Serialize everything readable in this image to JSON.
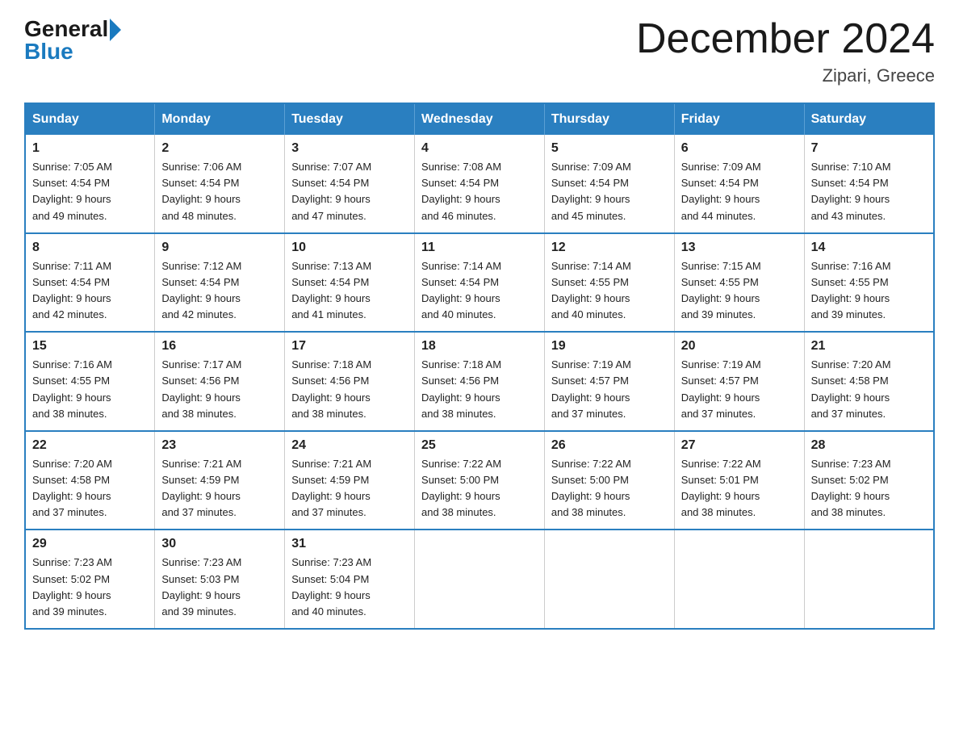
{
  "header": {
    "logo": {
      "general": "General",
      "blue": "Blue"
    },
    "title": "December 2024",
    "location": "Zipari, Greece"
  },
  "calendar": {
    "days_of_week": [
      "Sunday",
      "Monday",
      "Tuesday",
      "Wednesday",
      "Thursday",
      "Friday",
      "Saturday"
    ],
    "weeks": [
      [
        {
          "day": "1",
          "sunrise": "7:05 AM",
          "sunset": "4:54 PM",
          "daylight": "9 hours and 49 minutes."
        },
        {
          "day": "2",
          "sunrise": "7:06 AM",
          "sunset": "4:54 PM",
          "daylight": "9 hours and 48 minutes."
        },
        {
          "day": "3",
          "sunrise": "7:07 AM",
          "sunset": "4:54 PM",
          "daylight": "9 hours and 47 minutes."
        },
        {
          "day": "4",
          "sunrise": "7:08 AM",
          "sunset": "4:54 PM",
          "daylight": "9 hours and 46 minutes."
        },
        {
          "day": "5",
          "sunrise": "7:09 AM",
          "sunset": "4:54 PM",
          "daylight": "9 hours and 45 minutes."
        },
        {
          "day": "6",
          "sunrise": "7:09 AM",
          "sunset": "4:54 PM",
          "daylight": "9 hours and 44 minutes."
        },
        {
          "day": "7",
          "sunrise": "7:10 AM",
          "sunset": "4:54 PM",
          "daylight": "9 hours and 43 minutes."
        }
      ],
      [
        {
          "day": "8",
          "sunrise": "7:11 AM",
          "sunset": "4:54 PM",
          "daylight": "9 hours and 42 minutes."
        },
        {
          "day": "9",
          "sunrise": "7:12 AM",
          "sunset": "4:54 PM",
          "daylight": "9 hours and 42 minutes."
        },
        {
          "day": "10",
          "sunrise": "7:13 AM",
          "sunset": "4:54 PM",
          "daylight": "9 hours and 41 minutes."
        },
        {
          "day": "11",
          "sunrise": "7:14 AM",
          "sunset": "4:54 PM",
          "daylight": "9 hours and 40 minutes."
        },
        {
          "day": "12",
          "sunrise": "7:14 AM",
          "sunset": "4:55 PM",
          "daylight": "9 hours and 40 minutes."
        },
        {
          "day": "13",
          "sunrise": "7:15 AM",
          "sunset": "4:55 PM",
          "daylight": "9 hours and 39 minutes."
        },
        {
          "day": "14",
          "sunrise": "7:16 AM",
          "sunset": "4:55 PM",
          "daylight": "9 hours and 39 minutes."
        }
      ],
      [
        {
          "day": "15",
          "sunrise": "7:16 AM",
          "sunset": "4:55 PM",
          "daylight": "9 hours and 38 minutes."
        },
        {
          "day": "16",
          "sunrise": "7:17 AM",
          "sunset": "4:56 PM",
          "daylight": "9 hours and 38 minutes."
        },
        {
          "day": "17",
          "sunrise": "7:18 AM",
          "sunset": "4:56 PM",
          "daylight": "9 hours and 38 minutes."
        },
        {
          "day": "18",
          "sunrise": "7:18 AM",
          "sunset": "4:56 PM",
          "daylight": "9 hours and 38 minutes."
        },
        {
          "day": "19",
          "sunrise": "7:19 AM",
          "sunset": "4:57 PM",
          "daylight": "9 hours and 37 minutes."
        },
        {
          "day": "20",
          "sunrise": "7:19 AM",
          "sunset": "4:57 PM",
          "daylight": "9 hours and 37 minutes."
        },
        {
          "day": "21",
          "sunrise": "7:20 AM",
          "sunset": "4:58 PM",
          "daylight": "9 hours and 37 minutes."
        }
      ],
      [
        {
          "day": "22",
          "sunrise": "7:20 AM",
          "sunset": "4:58 PM",
          "daylight": "9 hours and 37 minutes."
        },
        {
          "day": "23",
          "sunrise": "7:21 AM",
          "sunset": "4:59 PM",
          "daylight": "9 hours and 37 minutes."
        },
        {
          "day": "24",
          "sunrise": "7:21 AM",
          "sunset": "4:59 PM",
          "daylight": "9 hours and 37 minutes."
        },
        {
          "day": "25",
          "sunrise": "7:22 AM",
          "sunset": "5:00 PM",
          "daylight": "9 hours and 38 minutes."
        },
        {
          "day": "26",
          "sunrise": "7:22 AM",
          "sunset": "5:00 PM",
          "daylight": "9 hours and 38 minutes."
        },
        {
          "day": "27",
          "sunrise": "7:22 AM",
          "sunset": "5:01 PM",
          "daylight": "9 hours and 38 minutes."
        },
        {
          "day": "28",
          "sunrise": "7:23 AM",
          "sunset": "5:02 PM",
          "daylight": "9 hours and 38 minutes."
        }
      ],
      [
        {
          "day": "29",
          "sunrise": "7:23 AM",
          "sunset": "5:02 PM",
          "daylight": "9 hours and 39 minutes."
        },
        {
          "day": "30",
          "sunrise": "7:23 AM",
          "sunset": "5:03 PM",
          "daylight": "9 hours and 39 minutes."
        },
        {
          "day": "31",
          "sunrise": "7:23 AM",
          "sunset": "5:04 PM",
          "daylight": "9 hours and 40 minutes."
        },
        null,
        null,
        null,
        null
      ]
    ],
    "labels": {
      "sunrise": "Sunrise:",
      "sunset": "Sunset:",
      "daylight": "Daylight:"
    }
  }
}
